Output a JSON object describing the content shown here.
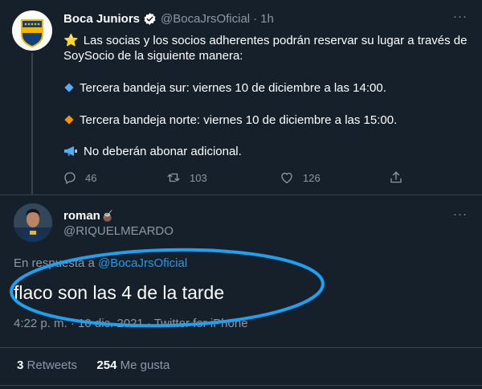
{
  "tweet1": {
    "author": "Boca Juniors",
    "handle": "@BocaJrsOficial",
    "time": "1h",
    "lines": {
      "intro1": "Las socias y los socios adherentes podrán reservar su lugar a través de",
      "intro2": "SoySocio de la siguiente manera:",
      "sur": "Tercera bandeja sur: viernes 10 de diciembre a las 14:00.",
      "norte": "Tercera bandeja norte: viernes 10 de diciembre a las 15:00.",
      "nota": "No deberán abonar adicional."
    },
    "stats": {
      "replies": "46",
      "retweets": "103",
      "likes": "126"
    },
    "icons": {
      "star": "⭐"
    },
    "colors": {
      "verified": "#1d9bf0",
      "bullet_blue": "#55acee",
      "bullet_orange": "#f4900c"
    }
  },
  "tweet2": {
    "author": "roman",
    "name_emoji": "🧉",
    "handle": "@RIQUELMEARDO",
    "reply_prefix": "En respuesta a",
    "reply_handle": "@BocaJrsOficial",
    "text": "flaco son las 4 de la tarde",
    "meta": "4:22 p. m. · 10 dic. 2021 · Twitter for iPhone",
    "retweets_count": "3",
    "retweets_label": "Retweets",
    "likes_count": "254",
    "likes_label": "Me gusta"
  },
  "theme": {
    "background": "#15202b",
    "muted": "#8b98a5",
    "link": "#1d9bf0",
    "annotation": "#1da1f2"
  }
}
